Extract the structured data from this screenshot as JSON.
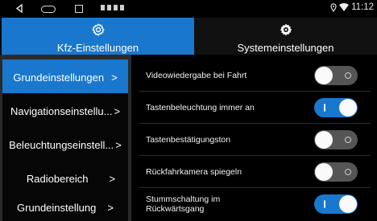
{
  "status": {
    "time": "11:12"
  },
  "tabs": [
    {
      "label": "Kfz-Einstellungen",
      "icon": "gear-icon",
      "active": true
    },
    {
      "label": "Systemeinstellungen",
      "icon": "system-gear-icon",
      "active": false
    }
  ],
  "sidebar": {
    "items": [
      {
        "label": "Grundeinstellungen",
        "active": true
      },
      {
        "label": "Navigationseinstellu...",
        "active": false
      },
      {
        "label": "Beleuchtungseinstell...",
        "active": false
      },
      {
        "label": "Radiobereich",
        "active": false
      },
      {
        "label": "Grundeinstellung",
        "active": false
      }
    ]
  },
  "settings": [
    {
      "label": "Videowiedergabe bei Fahrt",
      "on": false
    },
    {
      "label": "Tastenbeleuchtung immer an",
      "on": true
    },
    {
      "label": "Tastenbestätigungston",
      "on": false
    },
    {
      "label": "Rückfahrkamera spiegeln",
      "on": false
    },
    {
      "label_line1": "Stummschaltung im",
      "label_line2": "Rückwärtsgang",
      "on": true
    }
  ],
  "colors": {
    "accent": "#1978cd",
    "toggle_off": "#555555"
  }
}
